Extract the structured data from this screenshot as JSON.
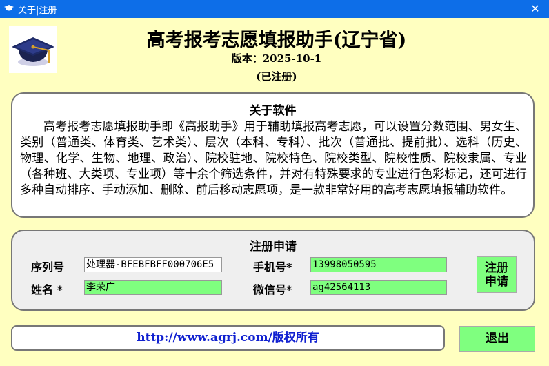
{
  "window": {
    "title": "关于|注册",
    "title_icon": "graduation-cap-icon",
    "close_glyph": "✕"
  },
  "header": {
    "app_title": "高考报考志愿填报助手(辽宁省)",
    "version": "版本：2025-10-1",
    "status": "(已注册)"
  },
  "about": {
    "heading": "关于软件",
    "body": "高考报考志愿填报助手即《高报助手》用于辅助填报高考志愿，可以设置分数范围、男女生、类别（普通类、体育类、艺术类）、层次（本科、专科）、批次（普通批、提前批）、选科（历史、物理、化学、生物、地理、政治）、院校驻地、院校特色、院校类型、院校性质、院校隶属、专业（各种班、大类项、专业项）等十余个筛选条件，并对有特殊要求的专业进行色彩标记，还可进行多种自动排序、手动添加、删除、前后移动志愿项，是一款非常好用的高考志愿填报辅助软件。"
  },
  "registration": {
    "heading": "注册申请",
    "serial_label": "序列号",
    "serial_value": "处理器-BFEBFBFF000706E5",
    "name_label": "姓名 *",
    "name_value": "李荣广",
    "phone_label": "手机号*",
    "phone_value": "13998050595",
    "wechat_label": "微信号*",
    "wechat_value": "ag42564113",
    "register_label_line1": "注册",
    "register_label_line2": "申请"
  },
  "footer": {
    "url_text": "http://www.agrj.com/版权所有",
    "exit_label": "退出"
  },
  "colors": {
    "background": "#ffffc0",
    "titlebar": "#0d6ee8",
    "field_green": "#7fff7f",
    "link_blue": "#1020d0"
  }
}
